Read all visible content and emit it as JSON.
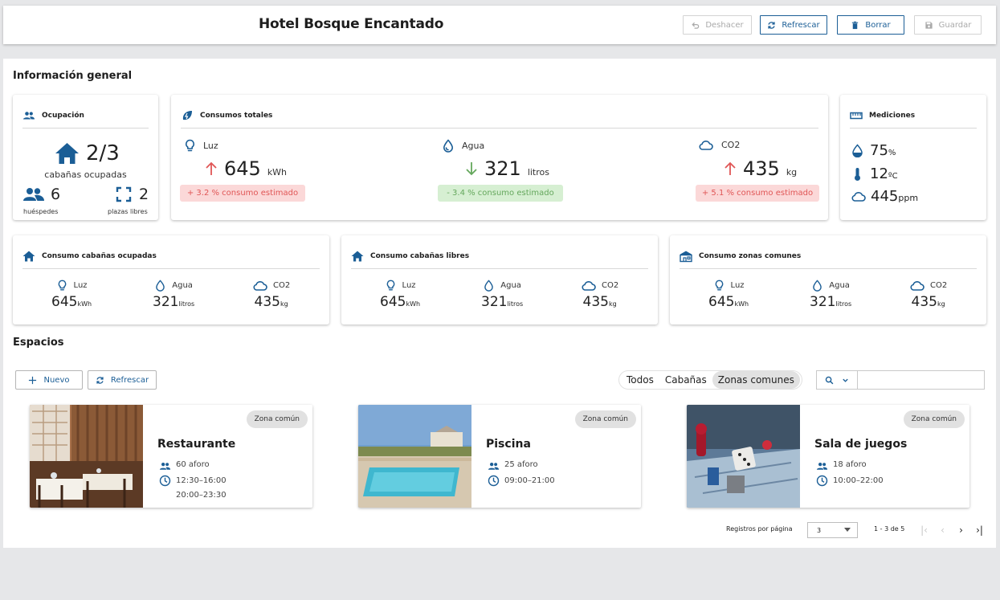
{
  "header": {
    "title": "Hotel Bosque Encantado",
    "undo_label": "Deshacer",
    "refresh_label": "Refrescar",
    "delete_label": "Borrar",
    "save_label": "Guardar"
  },
  "general": {
    "title": "Información general",
    "occupancy": {
      "title": "Ocupación",
      "cabins_value": "2/3",
      "cabins_label": "cabañas ocupadas",
      "guests_value": "6",
      "guests_label": "huéspedes",
      "free_value": "2",
      "free_label": "plazas libres"
    },
    "totals": {
      "title": "Consumos totales",
      "light": {
        "label": "Luz",
        "value": "645",
        "unit": "kWh",
        "trend": "up",
        "note": "+ 3.2 % consumo estimado"
      },
      "water": {
        "label": "Agua",
        "value": "321",
        "unit": "litros",
        "trend": "down",
        "note": "- 3.4 % consumo estimado"
      },
      "co2": {
        "label": "CO2",
        "value": "435",
        "unit": "kg",
        "trend": "up",
        "note": "+ 5.1 % consumo estimado"
      }
    },
    "measurements": {
      "title": "Mediciones",
      "humidity": {
        "value": "75",
        "unit": "%"
      },
      "temperature": {
        "value": "12",
        "unit": "ºC"
      },
      "co2": {
        "value": "445",
        "unit": "ppm"
      }
    },
    "occupied_cabins": {
      "title": "Consumo cabañas ocupadas",
      "light": {
        "label": "Luz",
        "value": "645",
        "unit": "kWh"
      },
      "water": {
        "label": "Agua",
        "value": "321",
        "unit": "litros"
      },
      "co2": {
        "label": "CO2",
        "value": "435",
        "unit": "kg"
      }
    },
    "free_cabins": {
      "title": "Consumo cabañas libres",
      "light": {
        "label": "Luz",
        "value": "645",
        "unit": "kWh"
      },
      "water": {
        "label": "Agua",
        "value": "321",
        "unit": "litros"
      },
      "co2": {
        "label": "CO2",
        "value": "435",
        "unit": "kg"
      }
    },
    "common_zones": {
      "title": "Consumo zonas comunes",
      "light": {
        "label": "Luz",
        "value": "645",
        "unit": "kWh"
      },
      "water": {
        "label": "Agua",
        "value": "321",
        "unit": "litros"
      },
      "co2": {
        "label": "CO2",
        "value": "435",
        "unit": "kg"
      }
    }
  },
  "spaces": {
    "title": "Espacios",
    "new_label": "Nuevo",
    "refresh_label": "Refrescar",
    "filters": [
      "Todos",
      "Cabañas",
      "Zonas comunes"
    ],
    "active_filter": "Zonas comunes",
    "search_placeholder": "",
    "items": [
      {
        "name": "Restaurante",
        "badge": "Zona común",
        "capacity": "60 aforo",
        "hours": [
          "12:30–16:00",
          "20:00–23:30"
        ]
      },
      {
        "name": "Piscina",
        "badge": "Zona común",
        "capacity": "25 aforo",
        "hours": [
          "09:00–21:00"
        ]
      },
      {
        "name": "Sala de juegos",
        "badge": "Zona común",
        "capacity": "18 aforo",
        "hours": [
          "10:00–22:00"
        ]
      }
    ]
  },
  "pagination": {
    "label": "Registros por página",
    "page_size": "3",
    "range": "1 - 3 de 5"
  },
  "colors": {
    "primary": "#1b5e96",
    "up": "#e05656",
    "down": "#64a75c"
  }
}
